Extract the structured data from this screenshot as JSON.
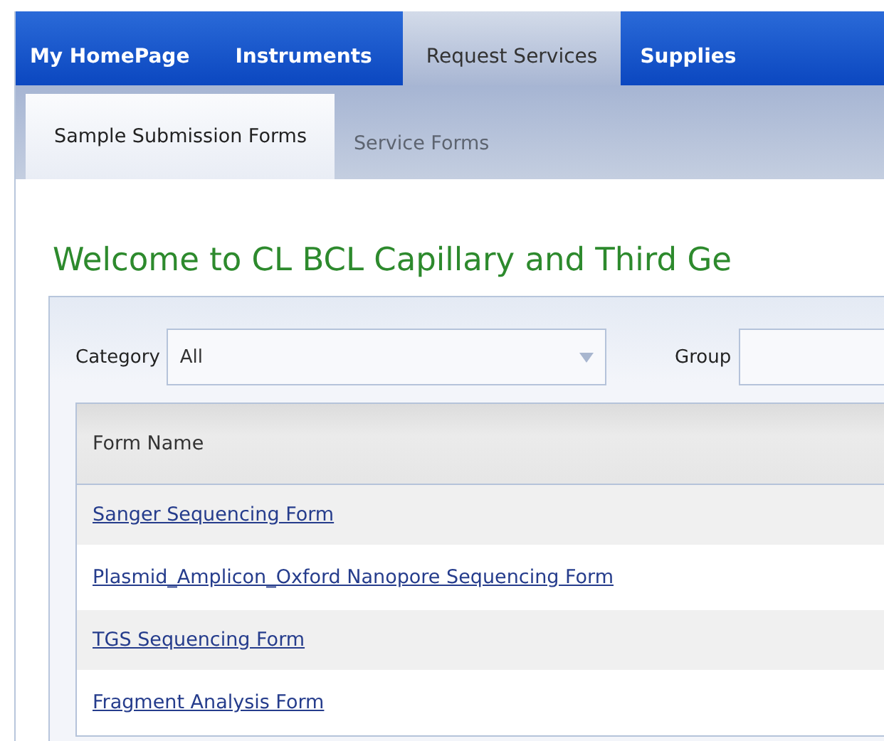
{
  "nav": [
    {
      "label": "My HomePage",
      "selected": false
    },
    {
      "label": "Instruments",
      "selected": false
    },
    {
      "label": "Request Services",
      "selected": true
    },
    {
      "label": "Supplies",
      "selected": false
    }
  ],
  "subnav": [
    {
      "label": "Sample Submission Forms",
      "selected": true
    },
    {
      "label": "Service Forms",
      "selected": false
    }
  ],
  "heading": "Welcome to CL BCL Capillary and Third Ge",
  "filters": [
    {
      "label": "Category",
      "value": "All"
    },
    {
      "label": "Group"
    }
  ],
  "table": {
    "columns": [
      "Form Name"
    ],
    "rows": [
      {
        "form_name": "Sanger Sequencing Form"
      },
      {
        "form_name": "Plasmid_Amplicon_Oxford Nanopore Sequencing Form"
      },
      {
        "form_name": "TGS Sequencing Form"
      },
      {
        "form_name": "Fragment Analysis Form"
      }
    ]
  }
}
